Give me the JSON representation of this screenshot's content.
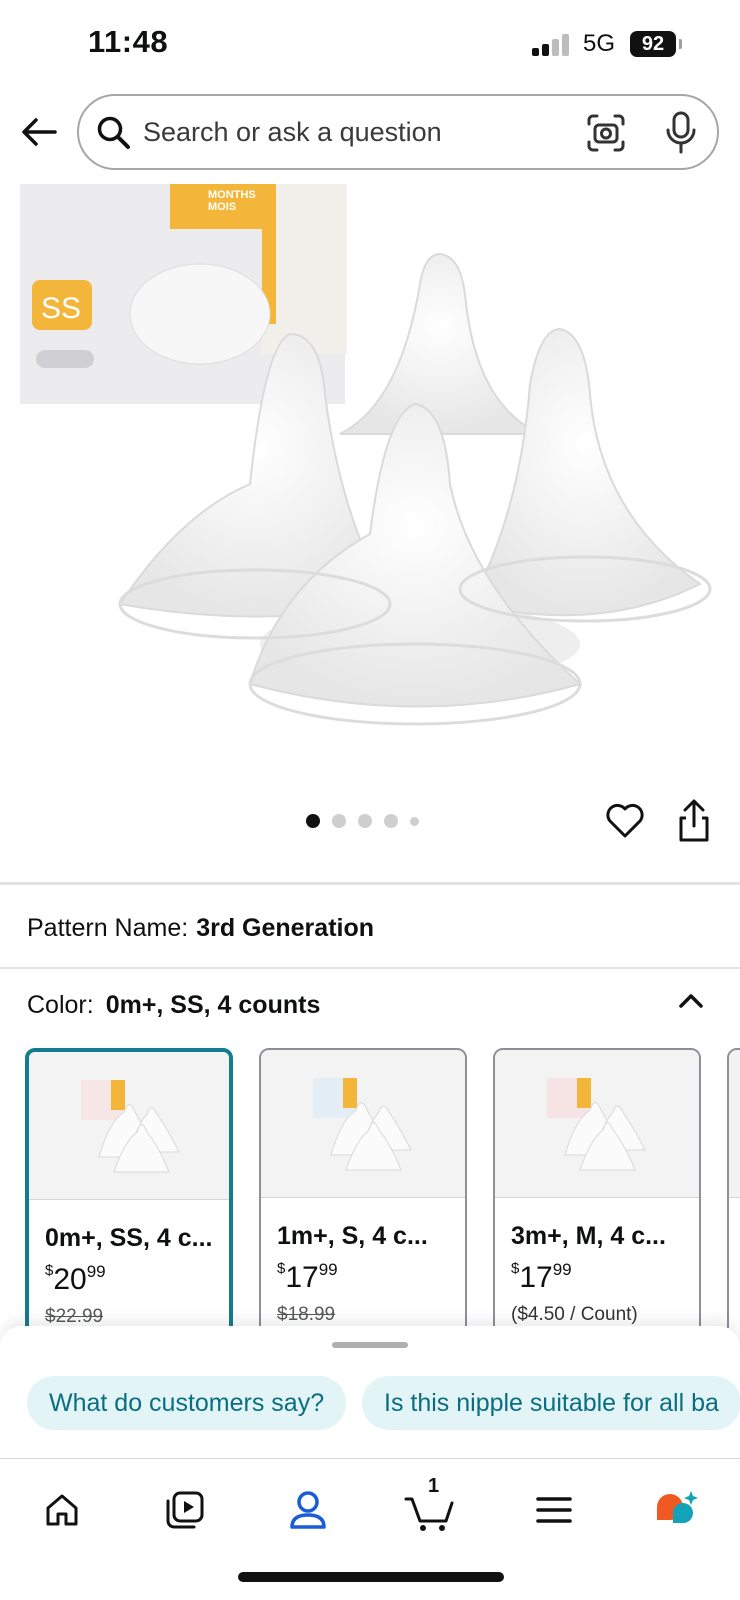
{
  "status_bar": {
    "time": "11:48",
    "network": "5G",
    "battery": "92"
  },
  "search": {
    "placeholder": "Search or ask a question"
  },
  "product_image": {
    "box_text": {
      "months": "MONTHS",
      "mois": "MOIS",
      "size": "SS"
    }
  },
  "carousel": {
    "total": 5,
    "active_index": 0
  },
  "pattern": {
    "label": "Pattern Name:",
    "value": "3rd Generation"
  },
  "color": {
    "label": "Color:",
    "value": "0m+, SS, 4 counts"
  },
  "variants": [
    {
      "name": "0m+, SS, 4 c...",
      "price_dollar": "20",
      "price_cents": "99",
      "sub": "$22.99",
      "selected": true
    },
    {
      "name": "1m+, S, 4 c...",
      "price_dollar": "17",
      "price_cents": "99",
      "sub": "$18.99",
      "selected": false
    },
    {
      "name": "3m+, M, 4 c...",
      "price_dollar": "17",
      "price_cents": "99",
      "sub": "($4.50 / Count)",
      "selected": false
    }
  ],
  "currency_symbol": "$",
  "chips": [
    "What do customers say?",
    "Is this nipple suitable for all ba"
  ],
  "nav": {
    "cart_count": "1"
  },
  "colors": {
    "accent": "#147c8f",
    "chip_bg": "#e3f4f7",
    "chip_text": "#0a6e80",
    "active_nav": "#1a5bd6"
  }
}
